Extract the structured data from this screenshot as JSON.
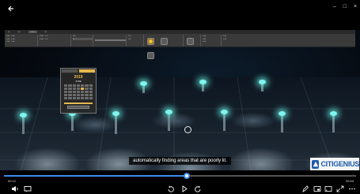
{
  "player": {
    "current_time": "00:12",
    "end_time": "00:53",
    "progress": 0.52,
    "subtitle": "automatically finding areas that are poorly lit."
  },
  "window_controls": [
    "–",
    "□",
    "×"
  ],
  "icons": {
    "back": "back-arrow-icon",
    "volume": "volume-icon",
    "captions": "captions-icon",
    "rewind": "rewind-10-icon",
    "play": "play-icon",
    "forward": "forward-30-icon",
    "edit": "pen-icon",
    "miniplayer": "miniplayer-icon",
    "cast": "cast-icon",
    "fullscreen": "fullscreen-icon",
    "more": "more-icon"
  },
  "colors": {
    "accent": "#3d8cf0",
    "app_accent": "#e6b84f",
    "glow": "#7ff5ef",
    "logo": "#1d5aa8"
  },
  "video_frame": {
    "calendar": {
      "year": "2019",
      "month": "JUNE"
    },
    "logo_text": "CITIGENIUS"
  }
}
